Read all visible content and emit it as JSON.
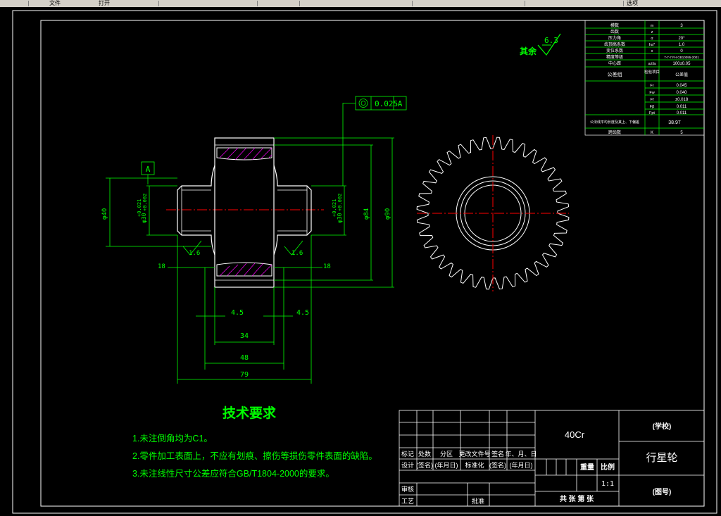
{
  "toolbar": {
    "items": [
      "文件",
      "",
      "打开",
      "",
      "",
      "",
      "",
      "",
      "",
      "",
      "选项"
    ]
  },
  "surface": {
    "label": "其余",
    "value": "6.3"
  },
  "datum_left": "A",
  "tolerance_frame": {
    "value": "0.025",
    "datum": "A"
  },
  "dims": {
    "d40": "φ40",
    "d30_left": "φ30",
    "tol_left": "+0.021",
    "tol_left2": "+0.002",
    "d30_right": "φ30",
    "tol_right": "+0.021",
    "tol_right2": "+0.002",
    "d84": "φ84",
    "d90": "φ90",
    "rough_left": "1.6",
    "rough_right": "1.6",
    "len18_left": "18",
    "len18_right": "18",
    "ch45_left": "4.5",
    "ch45_right": "4.5",
    "w34": "34",
    "w48": "48",
    "w79": "79"
  },
  "tech": {
    "title": "技术要求",
    "items": [
      "1.未注倒角均为C1。",
      "2.零件加工表面上，不应有划痕、擦伤等损伤零件表面的缺陷。",
      "3.未注线性尺寸公差应符合GB/T1804-2000的要求。"
    ]
  },
  "params": {
    "rows": [
      [
        "模数",
        "m",
        "3"
      ],
      [
        "齿数",
        "z",
        ""
      ],
      [
        "压力角",
        "α",
        "20°"
      ],
      [
        "齿顶高系数",
        "ha*",
        "1.0"
      ],
      [
        "变位系数",
        "x",
        "0"
      ],
      [
        "精度等级",
        "",
        "7-7-7 FH GB10095-2001"
      ],
      [
        "中心距",
        "a±fa",
        "100±0.05"
      ]
    ],
    "group_label": "公差组",
    "group_head": [
      "检验项目",
      "公差值"
    ],
    "group_rows": [
      [
        "Fr",
        "0.045"
      ],
      [
        "Fw",
        "0.040"
      ],
      [
        "Ff",
        "±0.018"
      ],
      [
        "Fβ",
        "0.011"
      ],
      [
        "Fpt",
        "0.011"
      ]
    ],
    "chord_label": "公法线平均长度及其上、下偏差",
    "chord_value": "38.97",
    "span_label": "跨齿数",
    "span_sym": "K",
    "span_value": "5"
  },
  "titleblock": {
    "material": "40Cr",
    "school": "(学校)",
    "part_name": "行星轮",
    "drawing_no": "(图号)",
    "header_row": [
      "标记",
      "处数",
      "分区",
      "更改文件号",
      "签名",
      "年、月、日"
    ],
    "design_row": [
      "设计",
      "(签名)",
      "(年月日)",
      "标准化",
      "(签名)",
      "(年月日)"
    ],
    "review": "审核",
    "craft": "工艺",
    "approve": "批准",
    "weight": "重量",
    "scale_label": "比例",
    "scale_value": "1:1",
    "sheets": "共  张  第  张"
  },
  "colors": {
    "outline": "#ffffff",
    "dim": "#00ff00",
    "center": "#ff0000",
    "hatch": "#ff00ff",
    "text_white": "#ffffff",
    "text_green": "#00ff00"
  }
}
